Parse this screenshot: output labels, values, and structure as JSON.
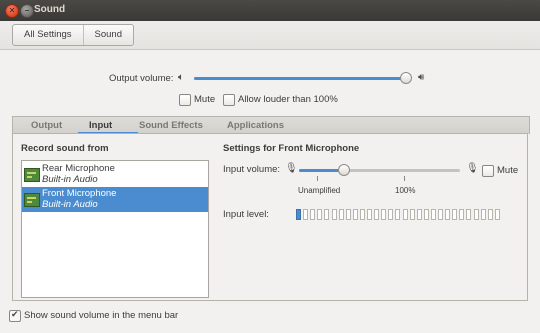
{
  "window": {
    "title": "Sound"
  },
  "toolbar": {
    "all_settings": "All Settings",
    "sound": "Sound"
  },
  "output_volume": {
    "label": "Output volume:",
    "level_percent": 98
  },
  "output_options": {
    "mute": "Mute",
    "mute_checked": false,
    "allow_louder": "Allow louder than 100%",
    "allow_louder_checked": false
  },
  "tabs": [
    {
      "label": "Output",
      "active": false
    },
    {
      "label": "Input",
      "active": true
    },
    {
      "label": "Sound Effects",
      "active": false
    },
    {
      "label": "Applications",
      "active": false
    }
  ],
  "record_from": {
    "heading": "Record sound from",
    "devices": [
      {
        "name": "Rear Microphone",
        "sub": "Built-in Audio",
        "selected": false
      },
      {
        "name": "Front Microphone",
        "sub": "Built-in Audio",
        "selected": true
      }
    ]
  },
  "settings": {
    "heading": "Settings for Front Microphone",
    "input_volume_label": "Input volume:",
    "input_level_percent": 28,
    "mute_label": "Mute",
    "mute_checked": false,
    "mark_unamplified": "Unamplified",
    "mark_100": "100%",
    "input_level_label": "Input level:",
    "input_level_bars_total": 29,
    "input_level_bars_lit": 1
  },
  "footer": {
    "show_in_menu_bar": "Show sound volume in the menu bar",
    "checked": true
  },
  "icons": {
    "speaker_low": "speaker-low-icon",
    "speaker_high": "speaker-high-icon",
    "mic_low": "mic-low-icon",
    "mic_high": "mic-high-icon"
  }
}
